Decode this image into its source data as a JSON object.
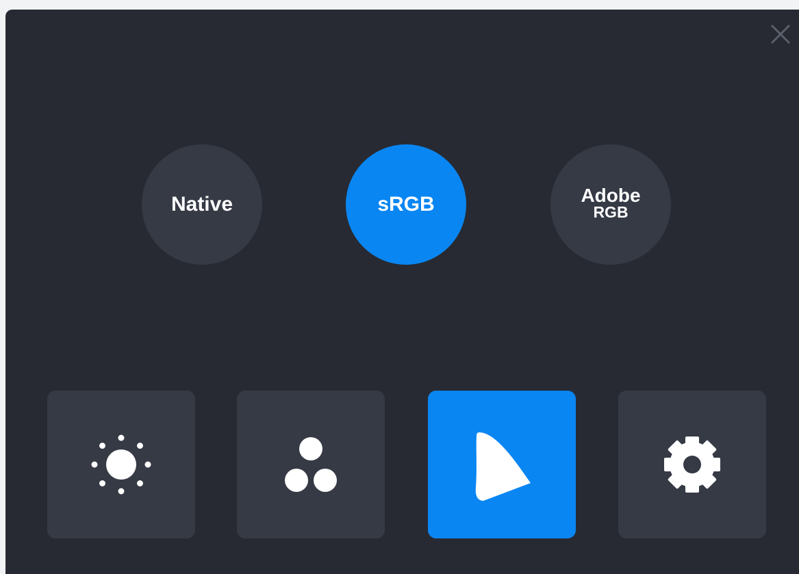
{
  "window": {
    "close_icon": "close-icon"
  },
  "color_modes": {
    "selected": "sRGB",
    "items": [
      {
        "id": "native",
        "label": "Native",
        "active": false
      },
      {
        "id": "srgb",
        "label": "sRGB",
        "active": true
      },
      {
        "id": "adobe",
        "label_line1": "Adobe",
        "label_line2": "RGB",
        "active": false
      }
    ]
  },
  "toolbar": {
    "items": [
      {
        "id": "brightness",
        "icon": "brightness-icon",
        "active": false
      },
      {
        "id": "color",
        "icon": "color-channels-icon",
        "active": false
      },
      {
        "id": "gamut",
        "icon": "color-gamut-icon",
        "active": true
      },
      {
        "id": "settings",
        "icon": "gear-icon",
        "active": false
      }
    ]
  },
  "colors": {
    "page_background": "#f2f3f5",
    "panel_background": "#272a32",
    "button_background": "#353a45",
    "accent": "#0a86f2",
    "text": "#ffffff",
    "close_icon": "#5a5f6a"
  }
}
